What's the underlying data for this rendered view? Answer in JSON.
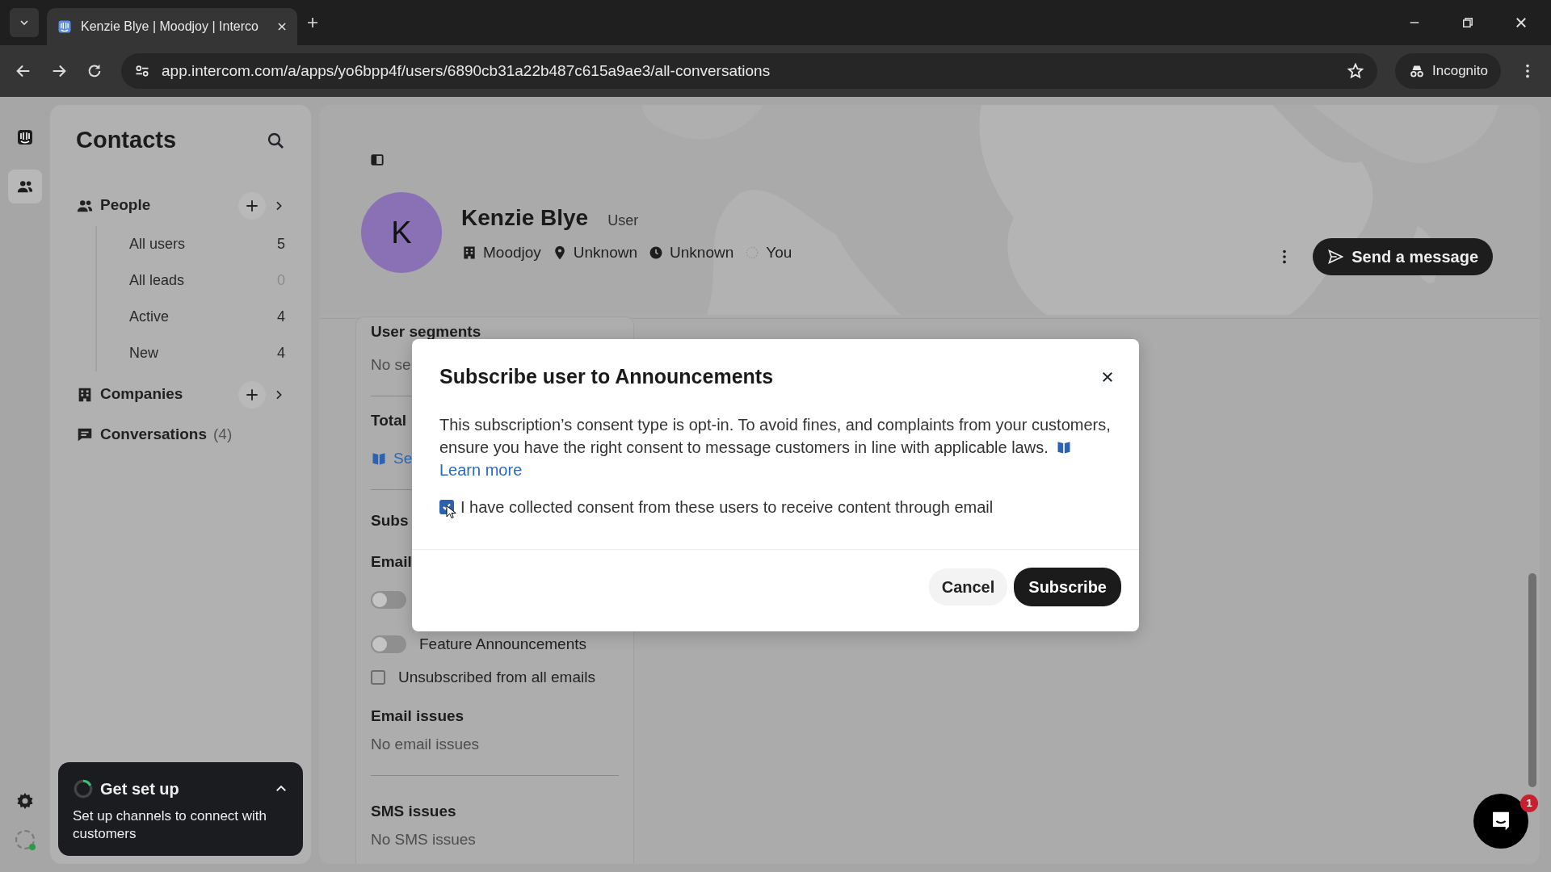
{
  "browser": {
    "tab_title": "Kenzie Blye | Moodjoy | Interco",
    "url": "app.intercom.com/a/apps/yo6bpp4f/users/6890cb31a22b487c615a9ae3/all-conversations",
    "profile": "Incognito"
  },
  "sidebar": {
    "title": "Contacts",
    "sections": [
      {
        "kind": "people",
        "label": "People",
        "add": true,
        "children": [
          {
            "label": "All users",
            "count": "5"
          },
          {
            "label": "All leads",
            "count": "0"
          },
          {
            "label": "Active",
            "count": "4"
          },
          {
            "label": "New",
            "count": "4"
          }
        ]
      },
      {
        "kind": "companies",
        "label": "Companies",
        "add": true
      },
      {
        "kind": "conversations",
        "label": "Conversations",
        "count": "(4)"
      }
    ]
  },
  "setup_card": {
    "title": "Get set up",
    "text": "Set up channels to connect with customers"
  },
  "profile": {
    "initial": "K",
    "name": "Kenzie Blye",
    "role": "User",
    "meta": [
      {
        "kind": "company",
        "text": "Moodjoy"
      },
      {
        "kind": "location",
        "text": "Unknown"
      },
      {
        "kind": "time",
        "text": "Unknown"
      },
      {
        "kind": "owner",
        "text": "You"
      }
    ],
    "send_button": "Send a message"
  },
  "details": {
    "segments_title": "User segments",
    "segments_value": "No se",
    "total_title": "Total",
    "total_link": "Se",
    "subscriptions_title": "Subs",
    "email_title": "Email",
    "toggles": [
      {
        "on": false
      },
      {
        "label": "Feature Announcements",
        "on": false
      }
    ],
    "unsubscribe": {
      "label": "Unsubscribed from all emails",
      "checked": false
    },
    "issues": [
      {
        "title": "Email issues",
        "value": "No email issues"
      },
      {
        "title": "SMS issues",
        "value": "No SMS issues"
      }
    ]
  },
  "modal": {
    "title": "Subscribe user to Announcements",
    "body": "This subscription’s consent type is opt-in. To avoid fines, and complaints from your customers, ensure you have the right consent to message customers in line with applicable laws.",
    "link": "Learn more",
    "consent": {
      "label": "I have collected consent from these users to receive content through email",
      "checked": true
    },
    "cancel": "Cancel",
    "submit": "Subscribe"
  },
  "messenger": {
    "badge": "1"
  }
}
